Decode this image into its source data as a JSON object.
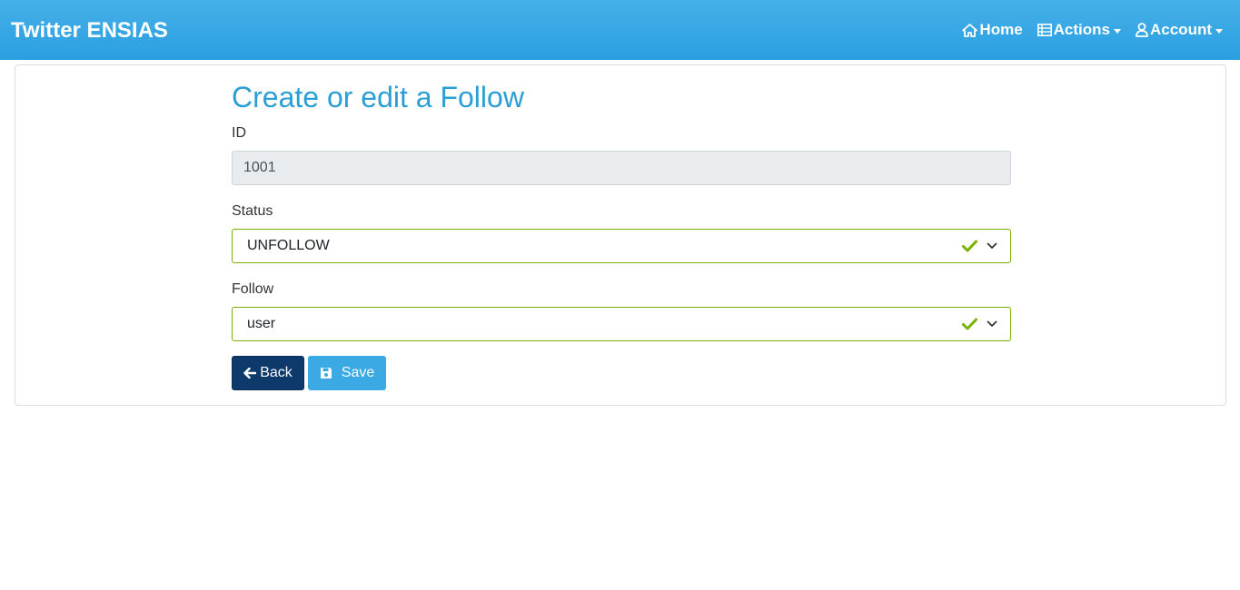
{
  "navbar": {
    "brand": "Twitter ENSIAS",
    "items": [
      {
        "label": "Home",
        "icon": "home-icon",
        "dropdown": false
      },
      {
        "label": "Actions",
        "icon": "list-icon",
        "dropdown": true
      },
      {
        "label": "Account",
        "icon": "user-icon",
        "dropdown": true
      }
    ]
  },
  "form": {
    "title": "Create or edit a Follow",
    "id_label": "ID",
    "id_value": "1001",
    "status_label": "Status",
    "status_value": "UNFOLLOW",
    "follow_label": "Follow",
    "follow_value": "user"
  },
  "buttons": {
    "back_label": "Back",
    "save_label": "Save"
  },
  "colors": {
    "navbar": "#2a9fd6",
    "title": "#2a9fd6",
    "valid": "#77b300",
    "back_button": "#0d3a6b",
    "save_button": "#3aa9e4"
  }
}
